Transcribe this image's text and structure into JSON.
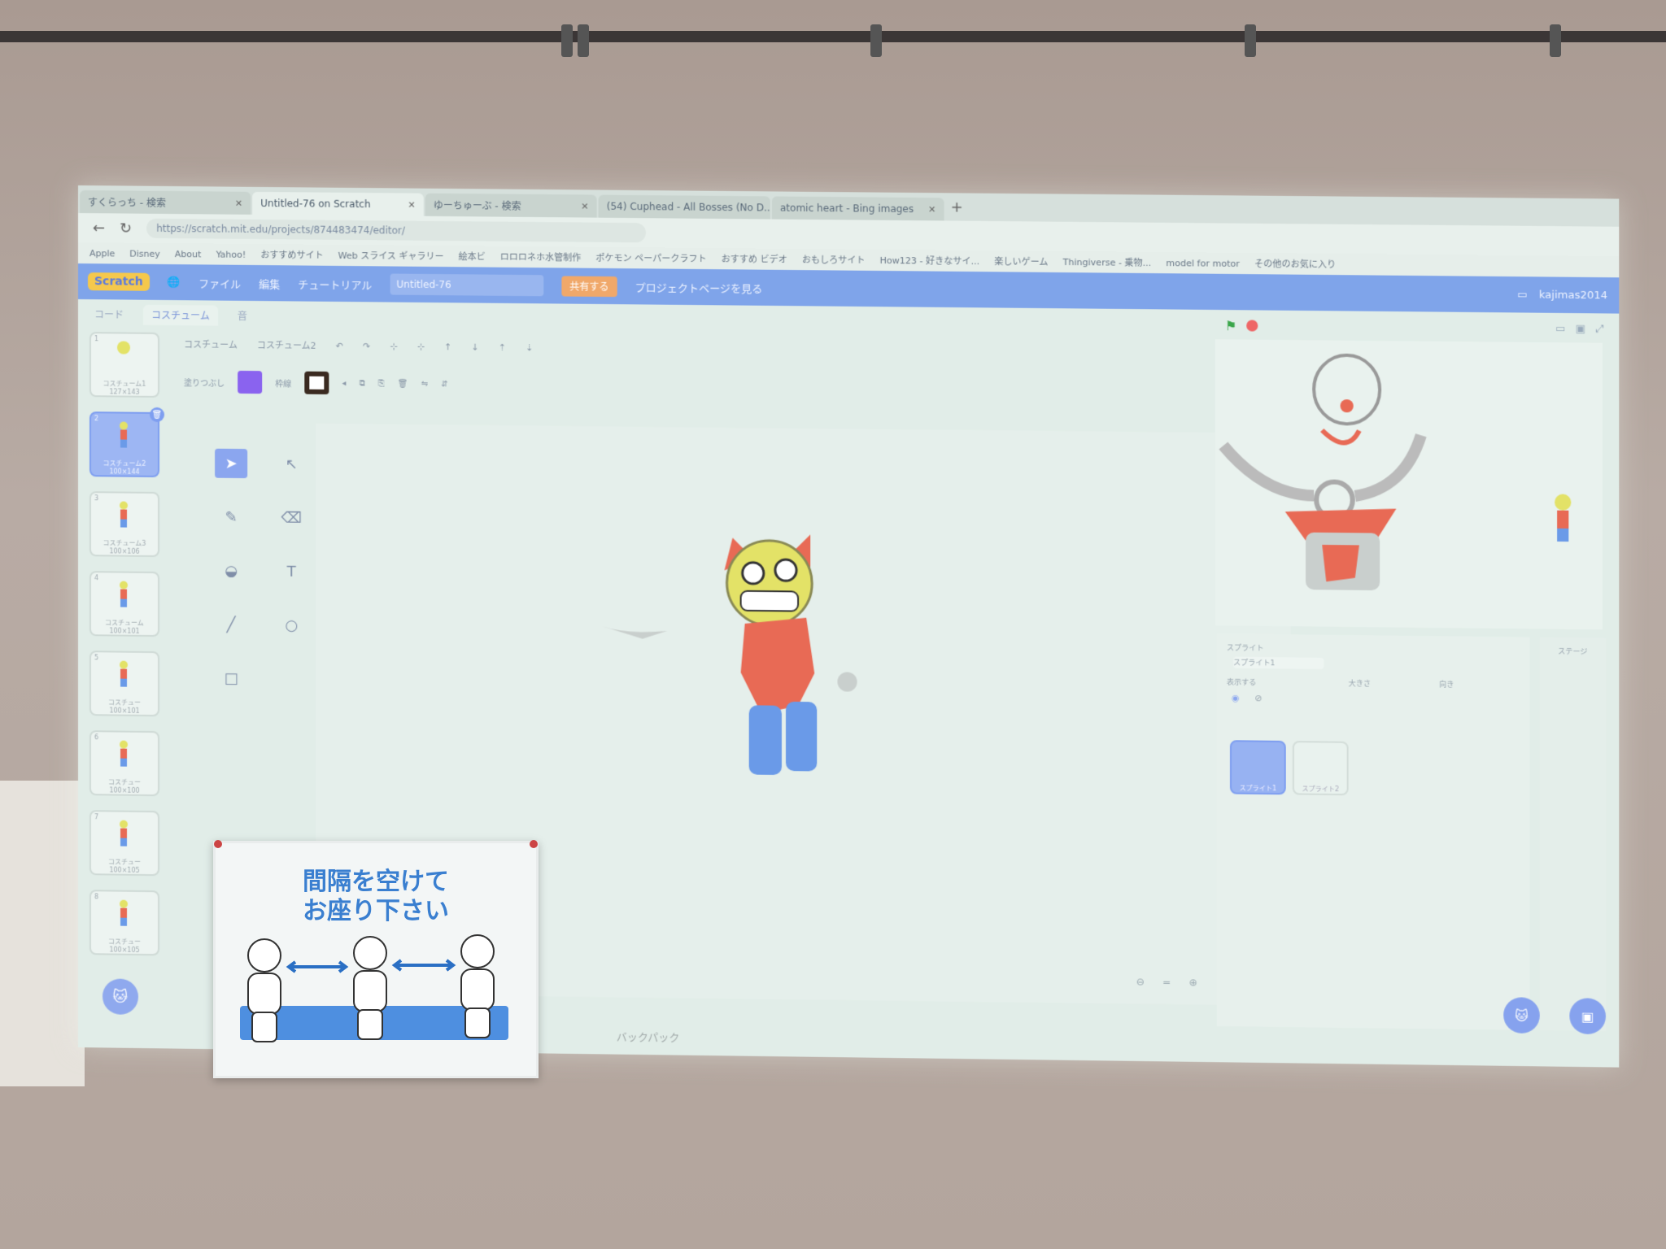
{
  "browser": {
    "tabs": [
      {
        "label": "すくらっち - 検索"
      },
      {
        "label": "Untitled-76 on Scratch"
      },
      {
        "label": "ゆーちゅーぶ - 検索"
      },
      {
        "label": "(54) Cuphead - All Bosses (No D..."
      },
      {
        "label": "atomic heart - Bing images"
      }
    ],
    "url": "https://scratch.mit.edu/projects/874483474/editor/",
    "bookmarks": [
      "Apple",
      "Disney",
      "About",
      "Yahoo!",
      "おすすめサイト",
      "Web スライス ギャラリー",
      "絵本ビ",
      "ロロロネホ水管制作",
      "ポケモン ペーパークラフト",
      "おすすめ ビデオ",
      "おもしろサイト",
      "How123 - 好きなサイ...",
      "楽しいゲーム",
      "Thingiverse - 乗物...",
      "model for motor",
      "その他のお気に入り"
    ]
  },
  "menubar": {
    "logo": "Scratch",
    "file": "ファイル",
    "edit": "編集",
    "tutorials": "チュートリアル",
    "project_title": "Untitled-76",
    "share": "共有する",
    "see_project_page": "プロジェクトページを見る",
    "user": "kajimas2014"
  },
  "editor_tabs": {
    "code": "コード",
    "costumes": "コスチューム",
    "sounds": "音"
  },
  "costumes": [
    {
      "n": "1",
      "name": "コスチューム1",
      "size": "127×143"
    },
    {
      "n": "2",
      "name": "コスチューム2",
      "size": "100×144"
    },
    {
      "n": "3",
      "name": "コスチューム3",
      "size": "100×106"
    },
    {
      "n": "4",
      "name": "コスチューム",
      "size": "100×101"
    },
    {
      "n": "5",
      "name": "コスチュー",
      "size": "100×101"
    },
    {
      "n": "6",
      "name": "コスチュー",
      "size": "100×100"
    },
    {
      "n": "7",
      "name": "コスチュー",
      "size": "100×105"
    },
    {
      "n": "8",
      "name": "コスチュー",
      "size": "100×105"
    }
  ],
  "paint_editor": {
    "costume_label": "コスチューム",
    "costume_name": "コスチューム2",
    "fill_label": "塗りつぶし",
    "outline_label": "枠線",
    "fill_color": "#8a63ef",
    "outline_color": "#3a2a20"
  },
  "canvas": {
    "zoom_minus": "⊖",
    "zoom_eq": "=",
    "zoom_plus": "⊕"
  },
  "backpack": "バックパック",
  "sprite_panel": {
    "label_sprite": "スプライト",
    "sprite_name": "スプライト1",
    "label_show": "表示する",
    "label_size": "大きさ",
    "label_direction": "向き",
    "sprites": [
      "スプライト1",
      "スプライト2"
    ],
    "stage_label": "ステージ"
  },
  "sign": {
    "text": "間隔を空けて\nお座り下さい"
  },
  "colors": {
    "menubar": "#7fa4ea",
    "accent": "#8ba6ef",
    "face": "#e3e267",
    "body": "#e86a55",
    "legs": "#6a9ae8",
    "sign_text": "#3a7fd0"
  }
}
